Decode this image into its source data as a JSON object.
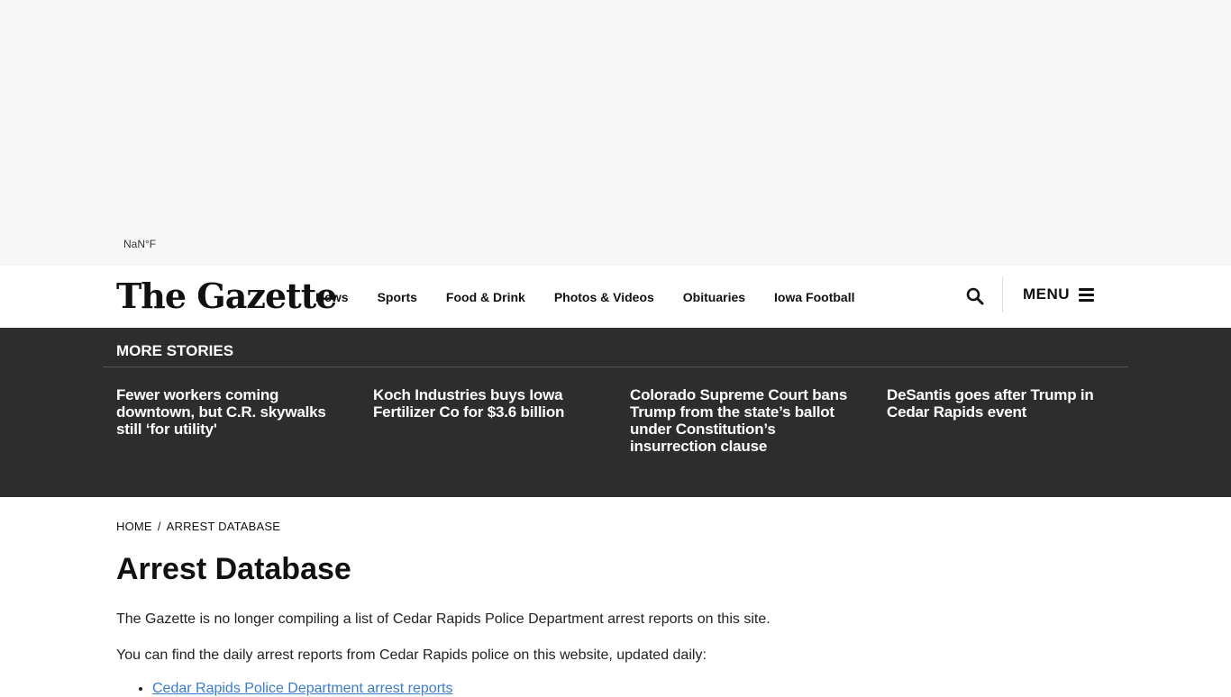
{
  "weather": {
    "temp": "NaN°F"
  },
  "header": {
    "logo": "The Gazette",
    "nav": [
      "News",
      "Sports",
      "Food & Drink",
      "Photos & Videos",
      "Obituaries",
      "Iowa Football"
    ],
    "menu_label": "MENU",
    "search_icon": "search-icon",
    "menu_icon": "hamburger-icon"
  },
  "more_stories": {
    "title": "MORE STORIES",
    "items": [
      "Fewer workers coming downtown, but C.R. skywalks still ‘for utility'",
      "Koch Industries buys Iowa Fertilizer Co for $3.6 billion",
      "Colorado Supreme Court bans Trump from the state’s ballot under Constitution’s insurrection clause",
      "DeSantis goes after Trump in Cedar Rapids event"
    ]
  },
  "breadcrumb": {
    "home": "HOME",
    "separator": "/",
    "current": "ARREST DATABASE"
  },
  "page": {
    "title": "Arrest Database",
    "para1": "The Gazette is no longer compiling a list of Cedar Rapids Police Department arrest reports on this site.",
    "para2": "You can find the daily arrest reports from Cedar Rapids police on this website, updated daily:",
    "links": [
      "Cedar Rapids Police Department arrest reports"
    ]
  },
  "colors": {
    "dark_band": "#2d2d2d",
    "link": "#3a7bd5",
    "ad_bg": "#f7f7f7"
  }
}
